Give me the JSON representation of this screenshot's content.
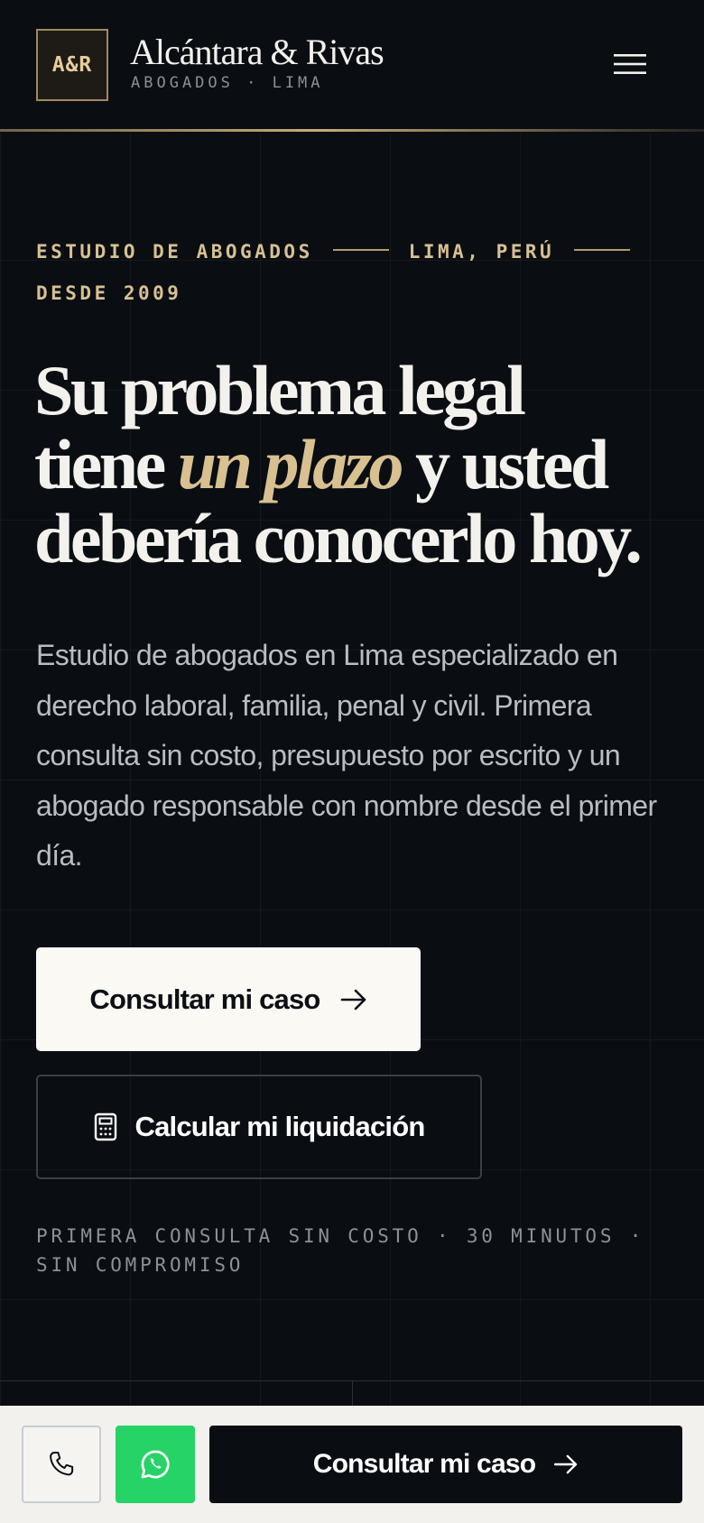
{
  "colors": {
    "background": "#0a0e13",
    "gold_accent": "#d8c091",
    "whatsapp_green": "#25d366",
    "primary_button_bg": "#fbf9f4"
  },
  "header": {
    "logo_text": "A&R",
    "brand_name": "Alcántara & Rivas",
    "brand_subtitle": "ABOGADOS · LIMA",
    "menu_icon": "hamburger-menu-icon"
  },
  "hero": {
    "eyebrow": {
      "part1": "ESTUDIO DE ABOGADOS",
      "part2": "LIMA, PERÚ",
      "part3": "DESDE 2009"
    },
    "headline": {
      "line1": "Su problema legal",
      "line2_start": "tiene ",
      "line2_accent": "un plazo",
      "line2_end": " y usted",
      "line3": "debería conocerlo hoy."
    },
    "lead": "Estudio de abogados en Lima especializado en derecho laboral, familia, penal y civil. Primera consulta sin costo, presupuesto por escrito y un abogado responsable con nombre desde el primer día.",
    "primary_cta": {
      "label": "Consultar mi caso",
      "icon": "arrow-right-icon"
    },
    "secondary_cta": {
      "label": "Calcular mi liquidación",
      "icon": "calculator-icon"
    },
    "note": "PRIMERA CONSULTA SIN COSTO · 30 MINUTOS · SIN COMPROMISO"
  },
  "bottom_bar": {
    "phone_icon": "phone-icon",
    "whatsapp_icon": "whatsapp-icon",
    "cta_label": "Consultar mi caso",
    "cta_icon": "arrow-right-icon"
  }
}
